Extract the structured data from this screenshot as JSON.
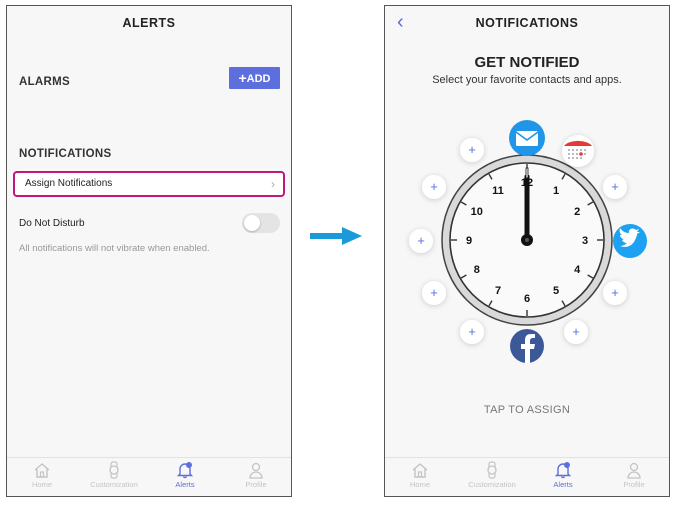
{
  "left_screen": {
    "header_title": "ALERTS",
    "alarms_label": "ALARMS",
    "add_button_label": "ADD",
    "add_button_icon": "plus-icon",
    "notifications_label": "NOTIFICATIONS",
    "assign_notifications_label": "Assign Notifications",
    "do_not_disturb_label": "Do Not Disturb",
    "do_not_disturb_enabled": false,
    "do_not_disturb_note": "All notifications will not vibrate when enabled."
  },
  "right_screen": {
    "header_title": "NOTIFICATIONS",
    "back_icon": "chevron-left-icon",
    "title": "GET NOTIFIED",
    "subtitle": "Select your favorite contacts and apps.",
    "clock_numbers": [
      "12",
      "1",
      "2",
      "3",
      "4",
      "5",
      "6",
      "7",
      "8",
      "9",
      "10",
      "11"
    ],
    "assigned_apps": [
      "mail-icon",
      "calendar-icon",
      "twitter-icon",
      "facebook-icon"
    ],
    "tap_to_assign": "TAP TO ASSIGN"
  },
  "tabbar": {
    "tabs": [
      {
        "label": "Home",
        "icon": "home-icon"
      },
      {
        "label": "Customization",
        "icon": "watch-icon"
      },
      {
        "label": "Alerts",
        "icon": "bell-icon"
      },
      {
        "label": "Profile",
        "icon": "person-icon"
      }
    ],
    "active_tab": "Alerts"
  },
  "colors": {
    "accent": "#5c6fdc",
    "highlight": "#c0177e",
    "arrow": "#1a9ad9",
    "mail": "#2196e8",
    "twitter": "#1da1f2",
    "facebook": "#3b5998",
    "calendar": "#e53935"
  }
}
